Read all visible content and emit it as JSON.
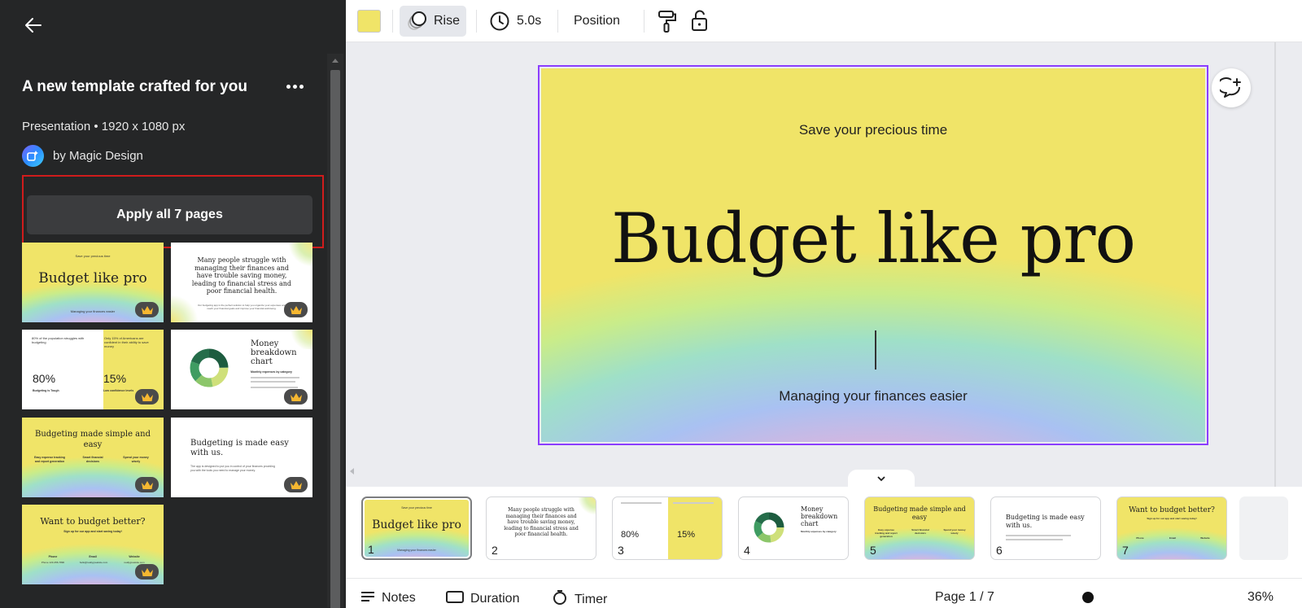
{
  "left_panel": {
    "title": "A new template crafted for you",
    "meta": "Presentation • 1920 x 1080 px",
    "author": "by Magic Design",
    "apply_label": "Apply all 7 pages"
  },
  "template_thumbs": [
    {
      "title": "Budget like pro",
      "sub": "Save your precious time",
      "tag": "Managing your finances easier"
    },
    {
      "text": "Many people struggle with managing their finances and have trouble saving money, leading to financial stress and poor financial health.",
      "small": "Our budgeting app is the perfect solution to help you organize your expenses and reach your financial goals and improve your financial well-being."
    },
    {
      "left_note": "80% of the population struggles with budgeting",
      "right_note": "Only 15% of Americans are confident in their ability to save money",
      "stat1": "80%",
      "stat2": "15%",
      "cap1": "Budgeting is Tough",
      "cap2": "Low confidence levels"
    },
    {
      "title": "Money breakdown chart",
      "sub": "Monthly expenses by category"
    },
    {
      "title": "Budgeting made simple and easy",
      "col1": "Easy expense tracking and report generation",
      "col2": "Smart financial decisions",
      "col3": "Spend your money wisely"
    },
    {
      "title": "Budgeting is made easy with us.",
      "small": "The app is designed to put you in control of your finances providing you with the tools you need to manage your money."
    },
    {
      "title": "Want to budget better?",
      "sub": "Sign up for our app and start saving today!",
      "c1": "Phone",
      "c2": "Email",
      "c3": "Website",
      "v1": "Phone 123-456-7890",
      "v2": "hello@reallygreatsite.com",
      "v3": "reallygreatsite.com"
    }
  ],
  "toolbar": {
    "swatch_color": "#f0e468",
    "animation_label": "Rise",
    "duration_label": "5.0s",
    "position_label": "Position"
  },
  "slide": {
    "subtitle": "Save your precious time",
    "title": "Budget like pro",
    "tagline": "Managing your finances easier"
  },
  "pages": [
    {
      "num": "1",
      "label": "Budget like pro",
      "sub": "Save your precious time",
      "tag": "Managing your finances easier"
    },
    {
      "num": "2",
      "label": "Many people struggle with managing their finances and have trouble saving money, leading to financial stress and poor financial health."
    },
    {
      "num": "3",
      "stat1": "80%",
      "stat2": "15%"
    },
    {
      "num": "4",
      "label": "Money breakdown chart",
      "sub": "Monthly expenses by category"
    },
    {
      "num": "5",
      "label": "Budgeting made simple and easy",
      "col1": "Easy expense tracking and report generation",
      "col2": "Smart financial decisions",
      "col3": "Spend your money wisely"
    },
    {
      "num": "6",
      "label": "Budgeting is made easy with us."
    },
    {
      "num": "7",
      "label": "Want to budget better?",
      "sub": "Sign up for our app and start saving today!",
      "c1": "Phone",
      "c2": "Email",
      "c3": "Website"
    }
  ],
  "footer": {
    "notes": "Notes",
    "duration": "Duration",
    "timer": "Timer",
    "page_indicator": "Page 1 / 7",
    "zoom": "36%"
  },
  "icons": [
    "back-arrow-icon",
    "more-icon",
    "magic-design-icon",
    "crown-icon",
    "chevron-left-icon",
    "rise-animation-icon",
    "clock-icon",
    "paint-roller-icon",
    "unlock-icon",
    "add-comment-icon",
    "chevron-down-icon"
  ]
}
